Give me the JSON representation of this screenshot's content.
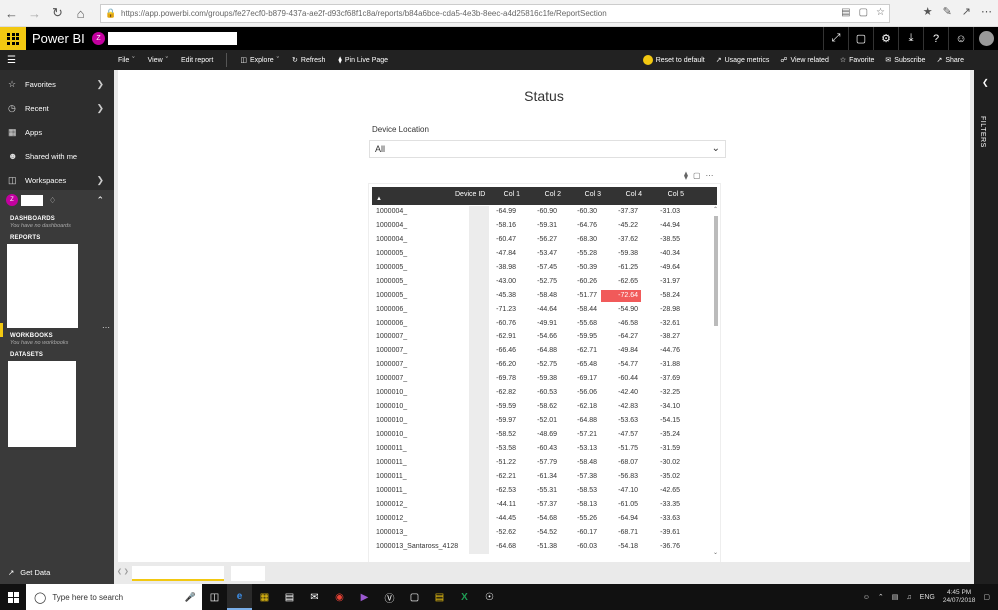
{
  "browser": {
    "url": "https://app.powerbi.com/groups/fe27ecf0-b879-437a-ae2f-d93cf68f1c8a/reports/b84a6bce-cda5-4e3b-8eec-a4d25816c1fe/ReportSection"
  },
  "topbar": {
    "brand": "Power BI",
    "workspace_initial": "Z"
  },
  "action_bar": {
    "menu": [
      {
        "label": "File",
        "icon": "chevron-down"
      },
      {
        "label": "View",
        "icon": "chevron-down"
      },
      {
        "label": "Edit report"
      },
      {
        "label": "Explore",
        "icon": "chevron-down"
      },
      {
        "label": "Refresh"
      },
      {
        "label": "Pin Live Page"
      }
    ],
    "right": [
      {
        "label": "Reset to default"
      },
      {
        "label": "Usage metrics"
      },
      {
        "label": "View related"
      },
      {
        "label": "Favorite"
      },
      {
        "label": "Subscribe"
      },
      {
        "label": "Share"
      }
    ]
  },
  "left_nav": {
    "items": [
      {
        "label": "Favorites",
        "icon": "star-icon"
      },
      {
        "label": "Recent",
        "icon": "clock-icon"
      },
      {
        "label": "Apps",
        "icon": "apps-icon"
      },
      {
        "label": "Shared with me",
        "icon": "shared-icon"
      },
      {
        "label": "Workspaces",
        "icon": "workspaces-icon"
      }
    ],
    "workspace_initial": "Z",
    "sections": {
      "dashboards": "DASHBOARDS",
      "dashboards_empty": "You have no dashboards",
      "reports": "REPORTS",
      "workbooks": "WORKBOOKS",
      "workbooks_empty": "You have no workbooks",
      "datasets": "DATASETS"
    },
    "get_data": "Get Data"
  },
  "report": {
    "title": "Status",
    "slicer_label": "Device Location",
    "slicer_value": "All",
    "filters_label": "FILTERS",
    "columns": [
      "Device ID",
      "Col 1",
      "Col 2",
      "Col 3",
      "Col 4",
      "Col 5"
    ],
    "highlight_color": "#f15a5a",
    "rows": [
      {
        "id": "1000004_",
        "c": [
          "-64.99",
          "-60.90",
          "-60.30",
          "-37.37",
          "-31.03"
        ]
      },
      {
        "id": "1000004_",
        "c": [
          "-58.16",
          "-59.31",
          "-64.76",
          "-45.22",
          "-44.94"
        ]
      },
      {
        "id": "1000004_",
        "c": [
          "-60.47",
          "-56.27",
          "-68.30",
          "-37.62",
          "-38.55"
        ]
      },
      {
        "id": "1000005_",
        "c": [
          "-47.84",
          "-53.47",
          "-55.28",
          "-59.38",
          "-40.34"
        ]
      },
      {
        "id": "1000005_",
        "c": [
          "-38.98",
          "-57.45",
          "-50.39",
          "-61.25",
          "-49.64"
        ]
      },
      {
        "id": "1000005_",
        "c": [
          "-43.00",
          "-52.75",
          "-60.26",
          "-62.65",
          "-31.97"
        ]
      },
      {
        "id": "1000005_",
        "c": [
          "-45.38",
          "-58.48",
          "-51.77",
          "-72.64",
          "-58.24"
        ],
        "hl": 3
      },
      {
        "id": "1000006_",
        "c": [
          "-71.23",
          "-44.64",
          "-58.44",
          "-54.90",
          "-28.98"
        ]
      },
      {
        "id": "1000006_",
        "c": [
          "-60.76",
          "-49.91",
          "-55.68",
          "-46.58",
          "-32.61"
        ]
      },
      {
        "id": "1000007_",
        "c": [
          "-62.91",
          "-54.66",
          "-59.95",
          "-64.27",
          "-38.27"
        ]
      },
      {
        "id": "1000007_",
        "c": [
          "-66.46",
          "-64.88",
          "-62.71",
          "-49.84",
          "-44.76"
        ]
      },
      {
        "id": "1000007_",
        "c": [
          "-66.20",
          "-52.75",
          "-65.48",
          "-54.77",
          "-31.88"
        ]
      },
      {
        "id": "1000007_",
        "c": [
          "-69.78",
          "-59.38",
          "-69.17",
          "-60.44",
          "-37.69"
        ]
      },
      {
        "id": "1000010_",
        "c": [
          "-62.82",
          "-60.53",
          "-56.06",
          "-42.40",
          "-32.25"
        ]
      },
      {
        "id": "1000010_",
        "c": [
          "-59.59",
          "-58.62",
          "-62.18",
          "-42.83",
          "-34.10"
        ]
      },
      {
        "id": "1000010_",
        "c": [
          "-59.97",
          "-52.01",
          "-64.88",
          "-53.63",
          "-54.15"
        ]
      },
      {
        "id": "1000010_",
        "c": [
          "-58.52",
          "-48.69",
          "-57.21",
          "-47.57",
          "-35.24"
        ]
      },
      {
        "id": "1000011_",
        "c": [
          "-53.58",
          "-60.43",
          "-53.13",
          "-51.75",
          "-31.59"
        ]
      },
      {
        "id": "1000011_",
        "c": [
          "-51.22",
          "-57.79",
          "-58.48",
          "-68.07",
          "-30.02"
        ]
      },
      {
        "id": "1000011_",
        "c": [
          "-62.21",
          "-61.34",
          "-57.38",
          "-56.83",
          "-35.02"
        ]
      },
      {
        "id": "1000011_",
        "c": [
          "-62.53",
          "-55.31",
          "-58.53",
          "-47.10",
          "-42.65"
        ]
      },
      {
        "id": "1000012_",
        "c": [
          "-44.11",
          "-57.37",
          "-58.13",
          "-61.05",
          "-33.35"
        ]
      },
      {
        "id": "1000012_",
        "c": [
          "-44.45",
          "-54.68",
          "-55.26",
          "-64.94",
          "-33.63"
        ]
      },
      {
        "id": "1000013_",
        "c": [
          "-52.62",
          "-54.52",
          "-60.17",
          "-68.71",
          "-39.61"
        ]
      },
      {
        "id": "1000013_Santaross_4128",
        "c": [
          "-64.68",
          "-51.38",
          "-60.03",
          "-54.18",
          "-36.76"
        ]
      }
    ]
  },
  "taskbar": {
    "search_placeholder": "Type here to search",
    "language": "ENG",
    "time": "4:45 PM",
    "date": "24/07/2018"
  }
}
